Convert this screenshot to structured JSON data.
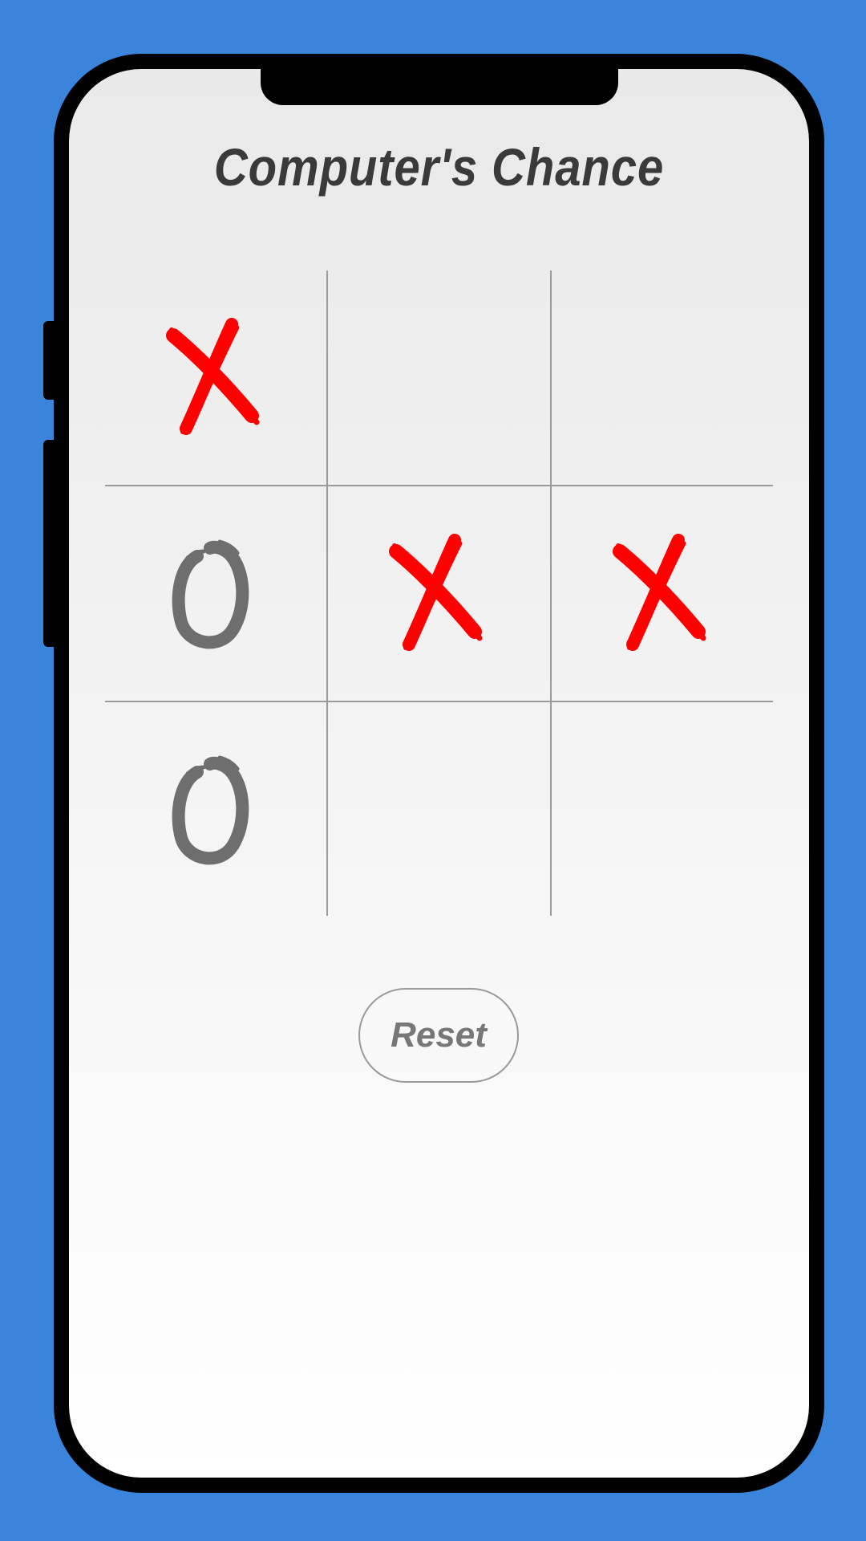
{
  "header": {
    "status_text": "Computer's Chance"
  },
  "board": {
    "cells": [
      "X",
      "",
      "",
      "O",
      "X",
      "X",
      "O",
      "",
      ""
    ]
  },
  "controls": {
    "reset_label": "Reset"
  },
  "colors": {
    "background": "#3a84dc",
    "x_mark": "#ff0000",
    "o_mark": "#6e6e6e",
    "title_text": "#3a3a3a",
    "grid_line": "#9a9a9a"
  }
}
